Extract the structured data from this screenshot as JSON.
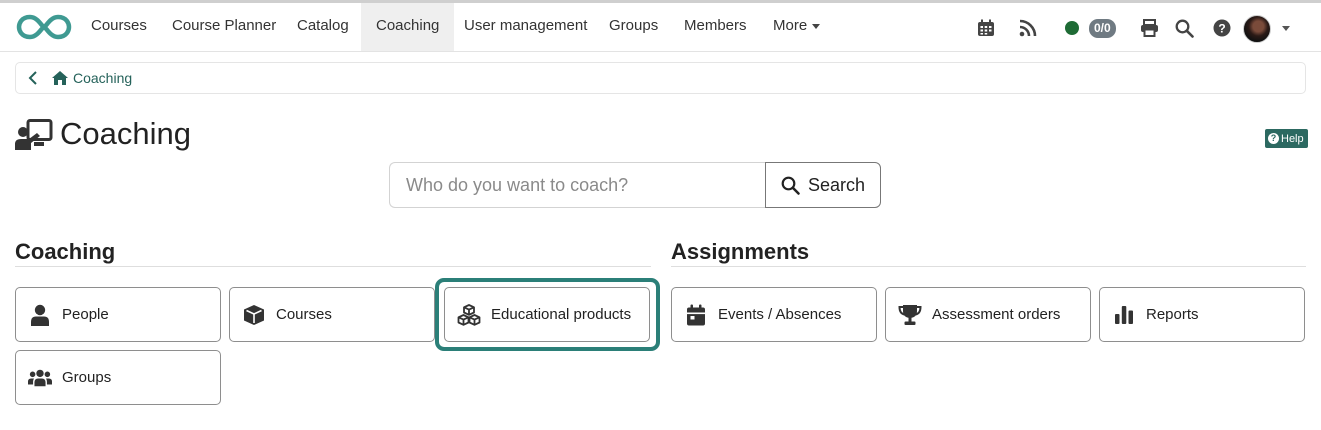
{
  "nav": {
    "items": [
      {
        "label": "Courses"
      },
      {
        "label": "Course Planner"
      },
      {
        "label": "Catalog"
      },
      {
        "label": "Coaching"
      },
      {
        "label": "User management"
      },
      {
        "label": "Groups"
      },
      {
        "label": "Members"
      },
      {
        "label": "More"
      }
    ],
    "active": "Coaching",
    "badge": "0/0",
    "status_color": "#1e6b35"
  },
  "breadcrumb": {
    "home_label": "Coaching"
  },
  "page": {
    "title": "Coaching",
    "help_label": "Help"
  },
  "search": {
    "placeholder": "Who do you want to coach?",
    "button_label": "Search"
  },
  "sections": {
    "coaching": {
      "title": "Coaching",
      "tiles": [
        {
          "label": "People",
          "icon": "person-icon"
        },
        {
          "label": "Courses",
          "icon": "cube-icon"
        },
        {
          "label": "Educational products",
          "icon": "cubes-icon"
        },
        {
          "label": "Groups",
          "icon": "users-icon"
        }
      ]
    },
    "assignments": {
      "title": "Assignments",
      "tiles": [
        {
          "label": "Events / Absences",
          "icon": "calendar-icon"
        },
        {
          "label": "Assessment orders",
          "icon": "trophy-icon"
        },
        {
          "label": "Reports",
          "icon": "bar-chart-icon"
        }
      ]
    }
  },
  "colors": {
    "accent": "#2b7f78",
    "link": "#25625a",
    "help_bg": "#2c6961"
  }
}
